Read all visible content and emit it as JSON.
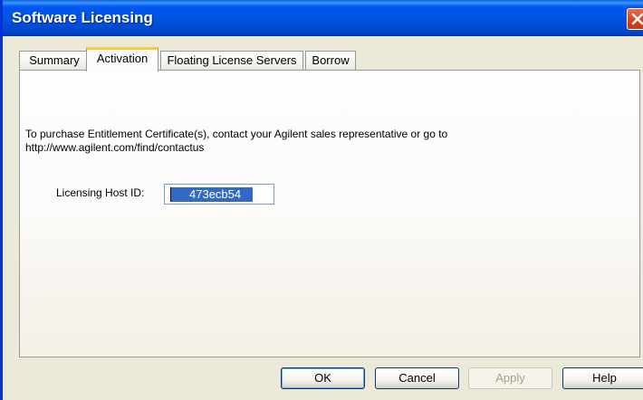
{
  "window": {
    "title": "Software Licensing"
  },
  "tabs": [
    {
      "label": "Summary",
      "active": false
    },
    {
      "label": "Activation",
      "active": true
    },
    {
      "label": "Floating License Servers",
      "active": false
    },
    {
      "label": "Borrow",
      "active": false
    }
  ],
  "activation": {
    "info_line1": "To purchase Entitlement Certificate(s), contact your Agilent sales representative or go to",
    "info_line2": "http://www.agilent.com/find/contactus",
    "host_id_label": "Licensing Host ID:",
    "host_id_value": "473ecb54"
  },
  "buttons": {
    "ok": "OK",
    "cancel": "Cancel",
    "apply": "Apply",
    "help": "Help"
  },
  "icons": {
    "close": "close-icon"
  },
  "colors": {
    "titlebar": "#0054e3",
    "selection": "#316ac5",
    "active_tab_accent": "#ffc83c"
  }
}
